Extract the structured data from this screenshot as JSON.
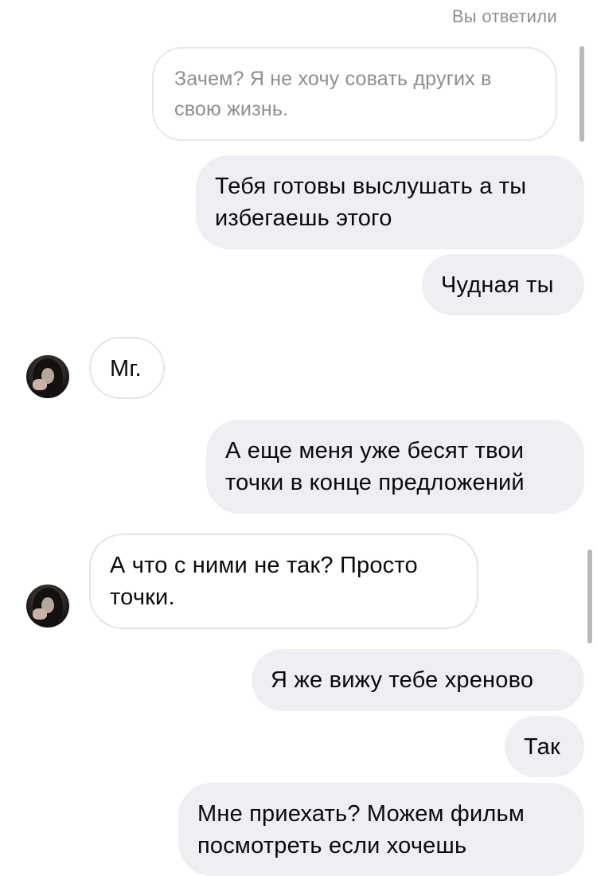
{
  "thread": {
    "reply_caption": "Вы ответили",
    "quoted_message": "Зачем? Я не хочу совать других в\nсвою жизнь.",
    "messages": [
      {
        "from": "me",
        "text": "Тебя готовы выслушать а ты\nизбегаешь этого"
      },
      {
        "from": "me",
        "text": "Чудная ты"
      },
      {
        "from": "them",
        "text": "Мг."
      },
      {
        "from": "me",
        "text": "А еще меня уже бесят твои\nточки в конце предложений"
      },
      {
        "from": "them",
        "text": "А что с ними не так? Просто\nточки."
      },
      {
        "from": "me",
        "text": "Я же вижу тебе хреново"
      },
      {
        "from": "me",
        "text": "Так"
      },
      {
        "from": "me",
        "text": "Мне приехать? Можем фильм\nпосмотреть если хочешь"
      }
    ]
  },
  "colors": {
    "outgoing_bubble": "#efeef3",
    "incoming_border": "#e3e3e8",
    "caption": "#8e8e93"
  }
}
